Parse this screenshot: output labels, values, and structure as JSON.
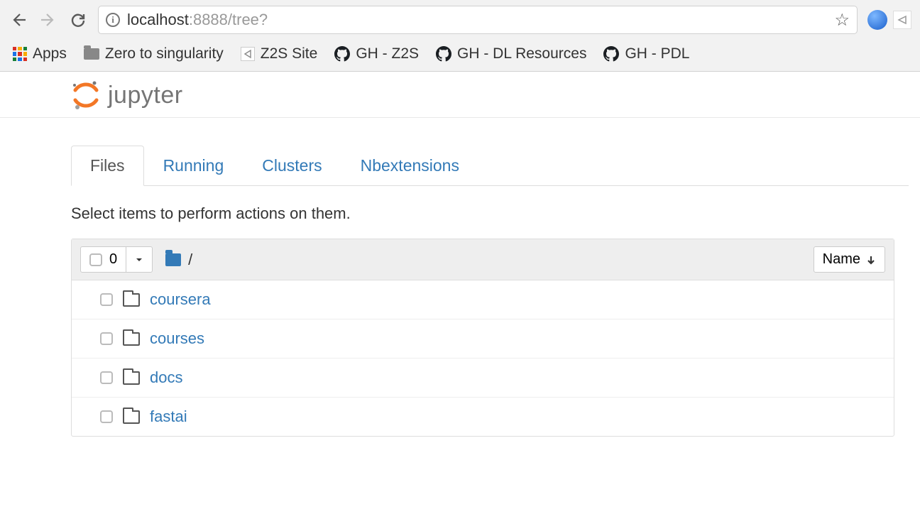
{
  "browser": {
    "url_host": "localhost",
    "url_port_path": ":8888/tree?",
    "bookmarks": {
      "apps": "Apps",
      "zts": "Zero to singularity",
      "z2s_site": "Z2S Site",
      "gh_z2s": "GH - Z2S",
      "gh_dl": "GH - DL Resources",
      "gh_pdl": "GH - PDL"
    }
  },
  "jupyter": {
    "logo_text": "jupyter",
    "tabs": [
      {
        "label": "Files",
        "active": true
      },
      {
        "label": "Running",
        "active": false
      },
      {
        "label": "Clusters",
        "active": false
      },
      {
        "label": "Nbextensions",
        "active": false
      }
    ],
    "instructions": "Select items to perform actions on them.",
    "selected_count": "0",
    "breadcrumb_sep": "/",
    "sort_label": "Name",
    "items": [
      {
        "name": "coursera"
      },
      {
        "name": "courses"
      },
      {
        "name": "docs"
      },
      {
        "name": "fastai"
      }
    ]
  }
}
